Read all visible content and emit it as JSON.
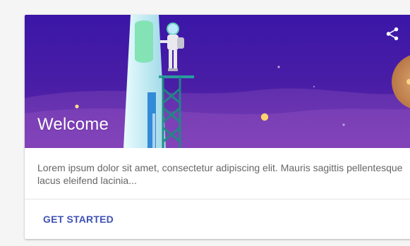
{
  "card": {
    "title": "Welcome",
    "description": "Lorem ipsum dolor sit amet, consectetur adipiscing elit. Mauris sagittis pellentesque lacus eleifend lacinia...",
    "action_label": "GET STARTED",
    "icons": {
      "share": "share-icon"
    },
    "colors": {
      "hero_top": "#3b16a7",
      "hero_bottom": "#5b2aa8",
      "action_text": "#3f51b5",
      "body_text": "#666666"
    }
  }
}
